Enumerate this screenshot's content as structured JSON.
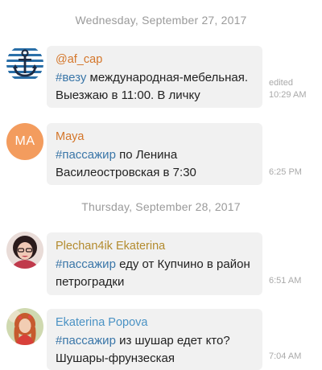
{
  "date_separators": [
    "Wednesday, September 27, 2017",
    "Thursday, September 28, 2017"
  ],
  "colors": {
    "hashtag": "#3a76a8",
    "bubble_bg": "#f1f1f1",
    "date_text": "#9a9a9a",
    "meta_text": "#a9a9a9"
  },
  "messages": [
    {
      "sender": "@af_cap",
      "sender_color": "#d4762a",
      "avatar": "anchor-icon",
      "hashtag": "#везу",
      "text": " международная-мебельная. Выезжаю в 11:00. В личку",
      "edited": "edited",
      "time": "10:29 AM"
    },
    {
      "sender": "Maya",
      "sender_color": "#d4762a",
      "avatar_initials": "MA",
      "avatar_color": "#f39c5e",
      "hashtag": "#пассажир",
      "text": " по Ленина Василеостровская в 7:30",
      "time": "6:25 PM"
    },
    {
      "sender": "Plechan4ik Ekaterina",
      "sender_color": "#b38b2e",
      "avatar": "user-photo",
      "hashtag": "#пассажир",
      "text": " еду от Купчино в район петроградки",
      "time": "6:51 AM"
    },
    {
      "sender": "Ekaterina Popova",
      "sender_color": "#4a92c4",
      "avatar": "user-photo",
      "hashtag": "#пассажир",
      "text": " из шушар едет кто?\nШушары-фрунзеская",
      "time": "7:04 AM"
    }
  ]
}
